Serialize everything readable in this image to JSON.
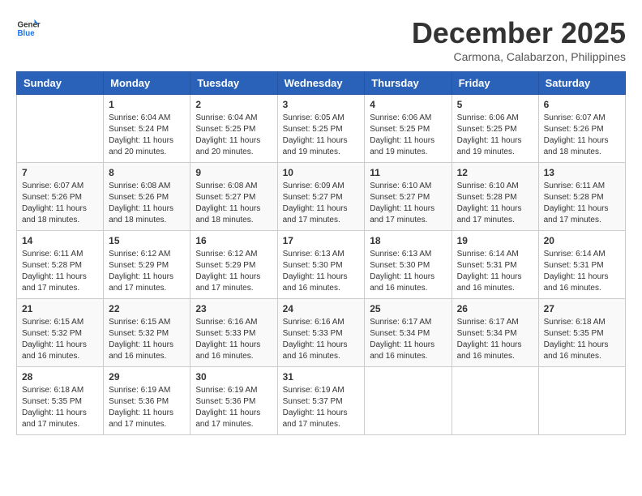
{
  "logo": {
    "line1": "General",
    "line2": "Blue"
  },
  "title": "December 2025",
  "subtitle": "Carmona, Calabarzon, Philippines",
  "weekdays": [
    "Sunday",
    "Monday",
    "Tuesday",
    "Wednesday",
    "Thursday",
    "Friday",
    "Saturday"
  ],
  "weeks": [
    [
      {
        "day": "",
        "sunrise": "",
        "sunset": "",
        "daylight": ""
      },
      {
        "day": "1",
        "sunrise": "6:04 AM",
        "sunset": "5:24 PM",
        "daylight": "11 hours and 20 minutes."
      },
      {
        "day": "2",
        "sunrise": "6:04 AM",
        "sunset": "5:25 PM",
        "daylight": "11 hours and 20 minutes."
      },
      {
        "day": "3",
        "sunrise": "6:05 AM",
        "sunset": "5:25 PM",
        "daylight": "11 hours and 19 minutes."
      },
      {
        "day": "4",
        "sunrise": "6:06 AM",
        "sunset": "5:25 PM",
        "daylight": "11 hours and 19 minutes."
      },
      {
        "day": "5",
        "sunrise": "6:06 AM",
        "sunset": "5:25 PM",
        "daylight": "11 hours and 19 minutes."
      },
      {
        "day": "6",
        "sunrise": "6:07 AM",
        "sunset": "5:26 PM",
        "daylight": "11 hours and 18 minutes."
      }
    ],
    [
      {
        "day": "7",
        "sunrise": "6:07 AM",
        "sunset": "5:26 PM",
        "daylight": "11 hours and 18 minutes."
      },
      {
        "day": "8",
        "sunrise": "6:08 AM",
        "sunset": "5:26 PM",
        "daylight": "11 hours and 18 minutes."
      },
      {
        "day": "9",
        "sunrise": "6:08 AM",
        "sunset": "5:27 PM",
        "daylight": "11 hours and 18 minutes."
      },
      {
        "day": "10",
        "sunrise": "6:09 AM",
        "sunset": "5:27 PM",
        "daylight": "11 hours and 17 minutes."
      },
      {
        "day": "11",
        "sunrise": "6:10 AM",
        "sunset": "5:27 PM",
        "daylight": "11 hours and 17 minutes."
      },
      {
        "day": "12",
        "sunrise": "6:10 AM",
        "sunset": "5:28 PM",
        "daylight": "11 hours and 17 minutes."
      },
      {
        "day": "13",
        "sunrise": "6:11 AM",
        "sunset": "5:28 PM",
        "daylight": "11 hours and 17 minutes."
      }
    ],
    [
      {
        "day": "14",
        "sunrise": "6:11 AM",
        "sunset": "5:28 PM",
        "daylight": "11 hours and 17 minutes."
      },
      {
        "day": "15",
        "sunrise": "6:12 AM",
        "sunset": "5:29 PM",
        "daylight": "11 hours and 17 minutes."
      },
      {
        "day": "16",
        "sunrise": "6:12 AM",
        "sunset": "5:29 PM",
        "daylight": "11 hours and 17 minutes."
      },
      {
        "day": "17",
        "sunrise": "6:13 AM",
        "sunset": "5:30 PM",
        "daylight": "11 hours and 16 minutes."
      },
      {
        "day": "18",
        "sunrise": "6:13 AM",
        "sunset": "5:30 PM",
        "daylight": "11 hours and 16 minutes."
      },
      {
        "day": "19",
        "sunrise": "6:14 AM",
        "sunset": "5:31 PM",
        "daylight": "11 hours and 16 minutes."
      },
      {
        "day": "20",
        "sunrise": "6:14 AM",
        "sunset": "5:31 PM",
        "daylight": "11 hours and 16 minutes."
      }
    ],
    [
      {
        "day": "21",
        "sunrise": "6:15 AM",
        "sunset": "5:32 PM",
        "daylight": "11 hours and 16 minutes."
      },
      {
        "day": "22",
        "sunrise": "6:15 AM",
        "sunset": "5:32 PM",
        "daylight": "11 hours and 16 minutes."
      },
      {
        "day": "23",
        "sunrise": "6:16 AM",
        "sunset": "5:33 PM",
        "daylight": "11 hours and 16 minutes."
      },
      {
        "day": "24",
        "sunrise": "6:16 AM",
        "sunset": "5:33 PM",
        "daylight": "11 hours and 16 minutes."
      },
      {
        "day": "25",
        "sunrise": "6:17 AM",
        "sunset": "5:34 PM",
        "daylight": "11 hours and 16 minutes."
      },
      {
        "day": "26",
        "sunrise": "6:17 AM",
        "sunset": "5:34 PM",
        "daylight": "11 hours and 16 minutes."
      },
      {
        "day": "27",
        "sunrise": "6:18 AM",
        "sunset": "5:35 PM",
        "daylight": "11 hours and 16 minutes."
      }
    ],
    [
      {
        "day": "28",
        "sunrise": "6:18 AM",
        "sunset": "5:35 PM",
        "daylight": "11 hours and 17 minutes."
      },
      {
        "day": "29",
        "sunrise": "6:19 AM",
        "sunset": "5:36 PM",
        "daylight": "11 hours and 17 minutes."
      },
      {
        "day": "30",
        "sunrise": "6:19 AM",
        "sunset": "5:36 PM",
        "daylight": "11 hours and 17 minutes."
      },
      {
        "day": "31",
        "sunrise": "6:19 AM",
        "sunset": "5:37 PM",
        "daylight": "11 hours and 17 minutes."
      },
      {
        "day": "",
        "sunrise": "",
        "sunset": "",
        "daylight": ""
      },
      {
        "day": "",
        "sunrise": "",
        "sunset": "",
        "daylight": ""
      },
      {
        "day": "",
        "sunrise": "",
        "sunset": "",
        "daylight": ""
      }
    ]
  ],
  "labels": {
    "sunrise_prefix": "Sunrise: ",
    "sunset_prefix": "Sunset: ",
    "daylight_prefix": "Daylight: "
  }
}
